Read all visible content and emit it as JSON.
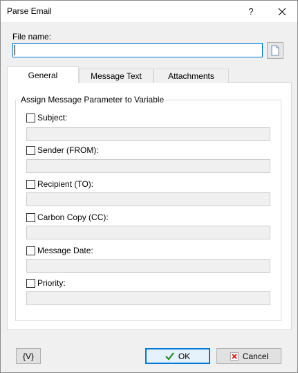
{
  "window": {
    "title": "Parse Email",
    "help_label": "?",
    "close_label": "✕"
  },
  "file": {
    "label": "File name:",
    "value": ""
  },
  "tabs": [
    {
      "label": "General",
      "active": true
    },
    {
      "label": "Message Text",
      "active": false
    },
    {
      "label": "Attachments",
      "active": false
    }
  ],
  "group": {
    "title": "Assign Message Parameter to Variable",
    "params": [
      {
        "label": "Subject:",
        "checked": false,
        "value": ""
      },
      {
        "label": "Sender (FROM):",
        "checked": false,
        "value": ""
      },
      {
        "label": "Recipient (TO):",
        "checked": false,
        "value": ""
      },
      {
        "label": "Carbon Copy (CC):",
        "checked": false,
        "value": ""
      },
      {
        "label": "Message Date:",
        "checked": false,
        "value": ""
      },
      {
        "label": "Priority:",
        "checked": false,
        "value": ""
      }
    ]
  },
  "footer": {
    "variables_label": "{V}",
    "ok_label": "OK",
    "cancel_label": "Cancel"
  },
  "colors": {
    "accent": "#0078d7",
    "ok_check": "#1e8a1e",
    "cancel_x": "#d11"
  },
  "icons": {
    "file_browse": "document-icon",
    "ok": "checkmark-icon",
    "cancel": "x-icon"
  }
}
